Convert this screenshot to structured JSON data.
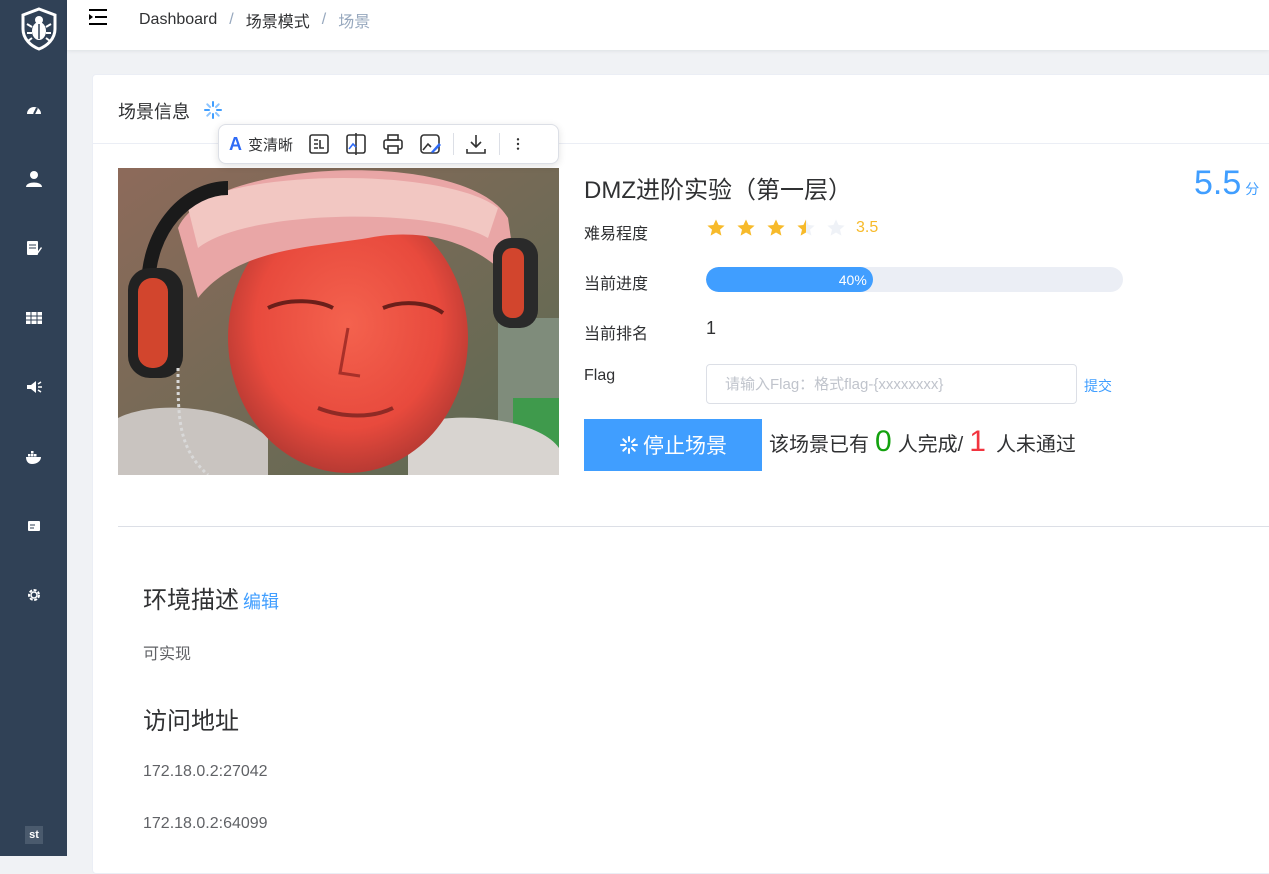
{
  "breadcrumb": {
    "home": "Dashboard",
    "parent": "场景模式",
    "current": "场景",
    "separator": "/"
  },
  "card": {
    "title": "场景信息"
  },
  "toolbar": {
    "ai_icon": "A",
    "ai_label": "变清晰"
  },
  "scene": {
    "title": "DMZ进阶实验（第一层）",
    "score": "5.5",
    "score_unit": "分",
    "difficulty_label": "难易程度",
    "rating": 3.5,
    "rating_text": "3.5",
    "progress_label": "当前进度",
    "progress": 0.4,
    "progress_text": "40%",
    "rank_label": "当前排名",
    "rank": "1",
    "flag_label": "Flag",
    "flag_placeholder": "请输入Flag：格式flag-{xxxxxxxx}",
    "submit_label": "提交",
    "stop_label": "停止场景",
    "stats_prefix": "该场景已有",
    "completed_count": "0",
    "completed_suffix": "人完成/",
    "failed_count": "1",
    "failed_suffix": "人未通过"
  },
  "description": {
    "title": "环境描述",
    "edit_label": "编辑",
    "text": "可实现"
  },
  "access": {
    "title": "访问地址",
    "addresses": [
      "172.18.0.2:27042",
      "172.18.0.2:64099"
    ]
  },
  "user": {
    "initials": "st"
  },
  "colors": {
    "sidebar": "#304156",
    "primary": "#409eff",
    "success": "#13a10e",
    "danger": "#f2343f",
    "star": "#f7ba2a"
  },
  "icons": [
    "shield-bug-logo",
    "dashboard-icon",
    "user-icon",
    "edit-doc-icon",
    "table-icon",
    "announce-icon",
    "docker-icon",
    "card-icon",
    "gear-icon"
  ]
}
